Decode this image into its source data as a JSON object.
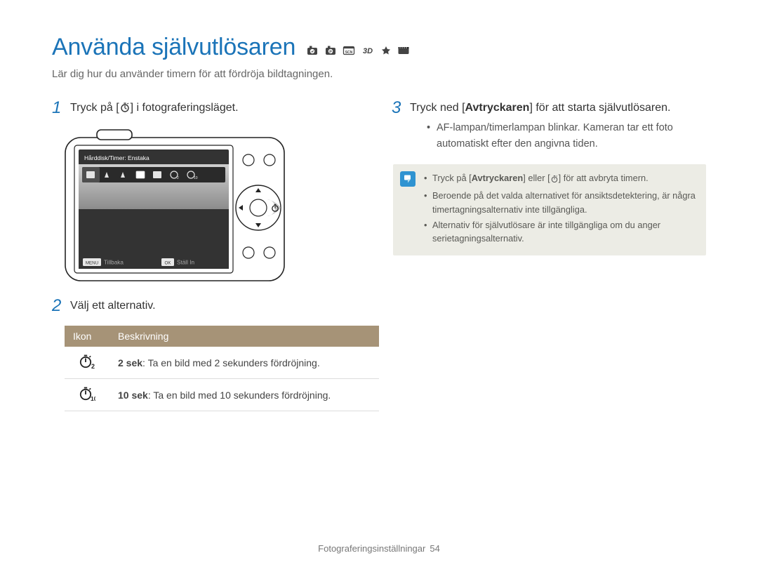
{
  "title": "Använda självutlösaren",
  "subtitle": "Lär dig hur du använder timern för att fördröja bildtagningen.",
  "step1": {
    "pre": "Tryck på [",
    "post": "] i fotograferingsläget."
  },
  "step2": {
    "text": "Välj ett alternativ."
  },
  "step3": {
    "pre": "Tryck ned [",
    "bold": "Avtryckaren",
    "post": "] för att starta självutlösaren."
  },
  "right_bullet1": "AF-lampan/timerlampan blinkar. Kameran tar ett foto automatiskt efter den angivna tiden.",
  "note_items": {
    "a": {
      "pre": "Tryck på [",
      "bold": "Avtryckaren",
      "mid": "] eller [",
      "post": "] för att avbryta timern."
    },
    "b": "Beroende på det valda alternativet för ansiktsdetektering, är några timertagningsalternativ inte tillgängliga.",
    "c": "Alternativ för självutlösare är inte tillgängliga om du anger serietagningsalternativ."
  },
  "lcd": {
    "title": "Hårddisk/Timer: Enstaka",
    "menu": "Tillbaka",
    "ok": "Ställ In",
    "menu_btn": "MENU",
    "ok_btn": "OK"
  },
  "options_table": {
    "headers": {
      "icon": "Ikon",
      "desc": "Beskrivning"
    },
    "rows": [
      {
        "bold": "2 sek",
        "rest": ": Ta en bild med 2 sekunders fördröjning.",
        "sub": "2"
      },
      {
        "bold": "10 sek",
        "rest": ": Ta en bild med 10 sekunders fördröjning.",
        "sub": "10"
      }
    ]
  },
  "footer": {
    "section": "Fotograferingsinställningar",
    "page": "54"
  }
}
